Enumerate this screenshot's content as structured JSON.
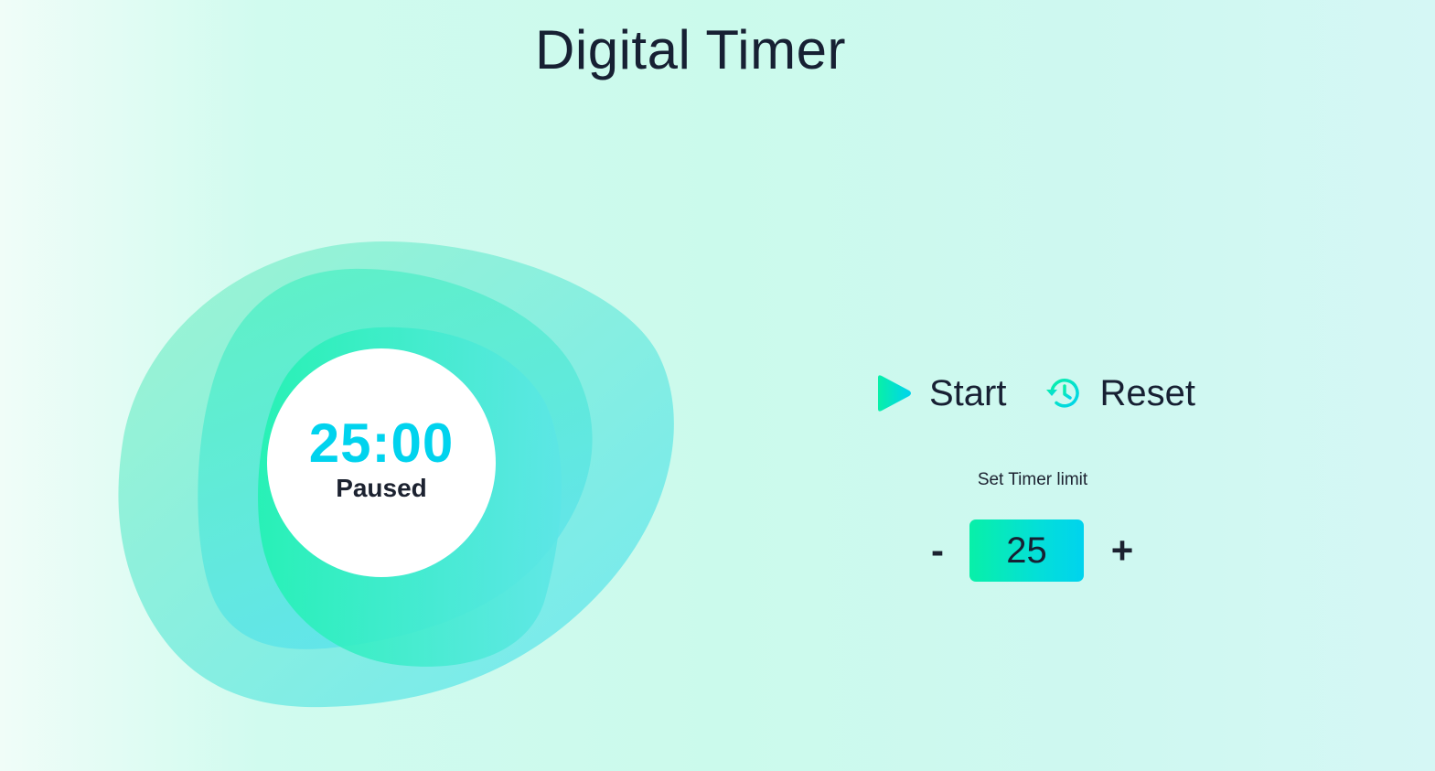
{
  "app": {
    "title": "Digital Timer"
  },
  "timer": {
    "display": "25:00",
    "status": "Paused"
  },
  "controls": {
    "start": {
      "label": "Start",
      "icon": "play-icon"
    },
    "reset": {
      "label": "Reset",
      "icon": "reset-clock-icon"
    }
  },
  "limit": {
    "label": "Set Timer limit",
    "value": "25",
    "decrement_label": "-",
    "increment_label": "+"
  },
  "colors": {
    "accent_green": "#08f0a8",
    "accent_cyan": "#00d3ee",
    "text_dark": "#172033"
  }
}
